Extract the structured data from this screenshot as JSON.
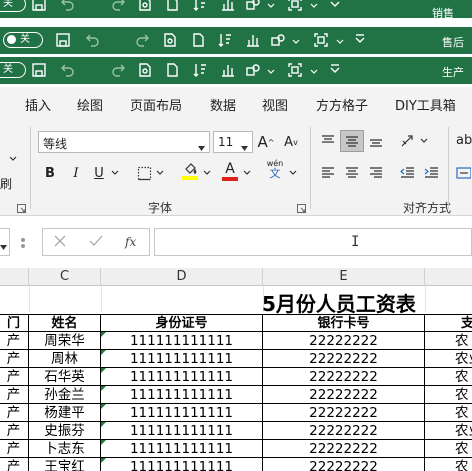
{
  "title_bars": [
    {
      "window_title": "销售",
      "toggle_label": "关"
    },
    {
      "window_title": "售后",
      "toggle_label": "关"
    },
    {
      "window_title": "生产",
      "toggle_label": "关"
    }
  ],
  "ribbon_tabs": [
    "插入",
    "绘图",
    "页面布局",
    "数据",
    "视图",
    "方方格子",
    "DIY工具箱"
  ],
  "ribbon": {
    "font_name": "等线",
    "font_size": "11",
    "grow_font": "A",
    "shrink_font": "A",
    "bold": "B",
    "italic": "I",
    "underline": "U",
    "phonetic": "wén",
    "phonetic_sub": "文",
    "font_group_label": "字体",
    "alignment_group_label": "对齐方式",
    "left_partial_label": "刷",
    "right_partial_label": "ab",
    "accent_colors": {
      "fill": "#ffff00",
      "font": "#e0201b"
    }
  },
  "formula_bar": {
    "fx_label": "fx",
    "content": ""
  },
  "columns": [
    "C",
    "D",
    "E"
  ],
  "sheet": {
    "title": "5月份人员工资表",
    "headers": {
      "dept": "门",
      "name": "姓名",
      "id": "身份证号",
      "card": "银行卡号",
      "bank": "支"
    },
    "rows": [
      {
        "dept": "产",
        "name": "周荣华",
        "id": "111111111111",
        "card": "22222222",
        "bank": "农"
      },
      {
        "dept": "产",
        "name": "周林",
        "id": "111111111111",
        "card": "22222222",
        "bank": "农业"
      },
      {
        "dept": "产",
        "name": "石华英",
        "id": "111111111111",
        "card": "22222222",
        "bank": "农"
      },
      {
        "dept": "产",
        "name": "孙金兰",
        "id": "111111111111",
        "card": "22222222",
        "bank": "农"
      },
      {
        "dept": "产",
        "name": "杨建平",
        "id": "111111111111",
        "card": "22222222",
        "bank": "农"
      },
      {
        "dept": "产",
        "name": "史振芬",
        "id": "111111111111",
        "card": "22222222",
        "bank": "农业"
      },
      {
        "dept": "产",
        "name": "卜志东",
        "id": "111111111111",
        "card": "22222222",
        "bank": "农"
      },
      {
        "dept": "产",
        "name": "王宝红",
        "id": "111111111111",
        "card": "22222222",
        "bank": "农"
      }
    ]
  }
}
